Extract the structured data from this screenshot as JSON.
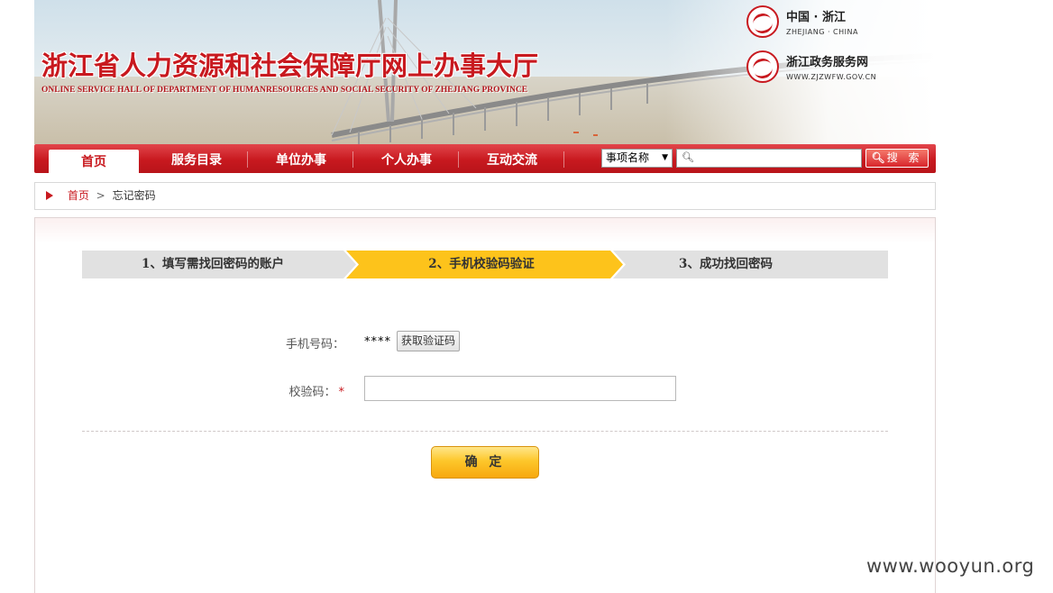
{
  "header": {
    "title": "浙江省人力资源和社会保障厅网上办事大厅",
    "subtitle": "ONLINE SERVICE HALL OF DEPARTMENT OF HUMANRESOURCES AND SOCIAL SECURITY OF ZHEJIANG PROVINCE",
    "logo1": {
      "main": "中国 · 浙江",
      "sub": "ZHEJIANG · CHINA"
    },
    "logo2": {
      "main": "浙江政务服务网",
      "sub": "WWW.ZJZWFW.GOV.CN"
    }
  },
  "nav": {
    "items": [
      {
        "label": "首页"
      },
      {
        "label": "服务目录"
      },
      {
        "label": "单位办事"
      },
      {
        "label": "个人办事"
      },
      {
        "label": "互动交流"
      }
    ],
    "search": {
      "select_value": "事项名称",
      "input_value": "",
      "button_label": "搜 索"
    }
  },
  "breadcrumb": {
    "home": "首页",
    "separator": ">",
    "current": "忘记密码"
  },
  "steps": [
    {
      "label": "1、填写需找回密码的账户",
      "active": false
    },
    {
      "label": "2、手机校验码验证",
      "active": true
    },
    {
      "label": "3、成功找回密码",
      "active": false
    }
  ],
  "form": {
    "phone_label": "手机号码：",
    "phone_value": "****",
    "get_code_button": "获取验证码",
    "code_label": "校验码：",
    "required_mark": "*",
    "code_value": "",
    "confirm_button": "确 定"
  },
  "watermark": "www.wooyun.org",
  "colors": {
    "brand_red": "#c8191f",
    "step_active": "#fdc31b",
    "step_inactive": "#e1e1e1",
    "confirm_button": "#fdc72b"
  }
}
